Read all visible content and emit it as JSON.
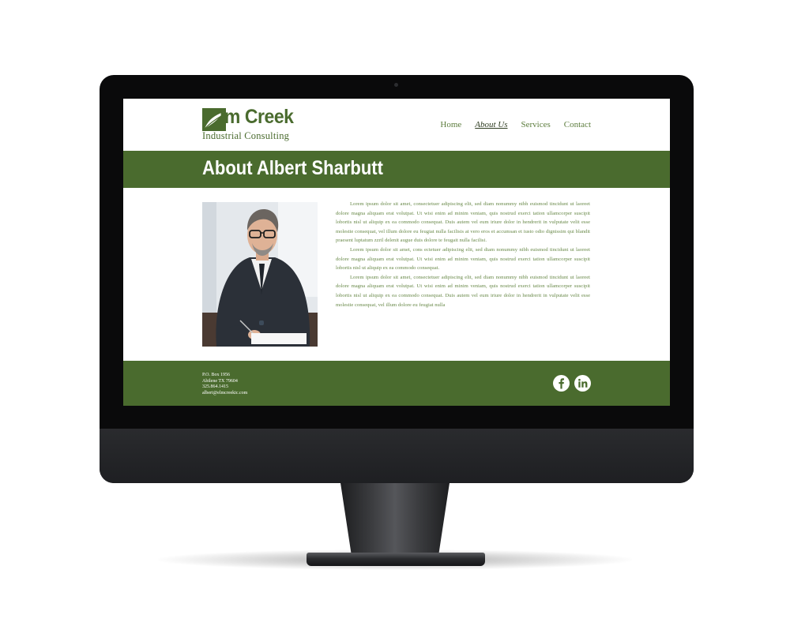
{
  "logo": {
    "title": "Elm Creek",
    "title_rest": "lm Creek",
    "subtitle": "Industrial Consulting"
  },
  "nav": {
    "items": [
      {
        "label": "Home",
        "active": false
      },
      {
        "label": "About Us",
        "active": true
      },
      {
        "label": "Services",
        "active": false
      },
      {
        "label": "Contact",
        "active": false
      }
    ]
  },
  "banner": {
    "title": "About Albert Sharbutt"
  },
  "bio": {
    "paragraphs": [
      "Lorem ipsum dolor sit amet, consectetuer adipiscing elit, sed diam nonummy nibh euismod tincidunt ut laoreet dolore magna aliquam erat volutpat. Ut wisi enim ad minim veniam, quis nostrud exerci tation ullamcorper suscipit lobortis nisl ut aliquip ex ea commodo consequat. Duis autem vel eum iriure dolor in hendrerit in vulputate velit esse molestie consequat, vel illum dolore eu feugiat nulla facilisis at vero eros et accumsan et iusto odio dignissim qui blandit praesent luptatum zzril delenit augue duis dolore te feugait nulla facilisi.",
      "Lorem ipsum dolor sit amet, cons ectetuer adipiscing elit, sed diam nonummy nibh euismod tincidunt ut laoreet dolore magna aliquam erat volutpat. Ut wisi enim ad minim veniam, quis nostrud exerci tation ullamcorper suscipit lobortis nisl ut aliquip ex ea commodo consequat.",
      "Lorem ipsum dolor sit amet, consectetuer adipiscing elit, sed diam nonummy nibh euismod tincidunt ut laoreet dolore magna aliquam erat volutpat. Ut wisi enim ad minim veniam, quis nostrud exerci tation ullamcorper suscipit lobortis nisl ut aliquip ex ea commodo consequat. Duis autem vel eum iriure dolor in hendrerit in vulputate velit esse molestie consequat, vel illum dolore eu feugiat nulla"
    ]
  },
  "footer": {
    "address_lines": [
      "P.O. Box 1956",
      "Abilene TX  79604",
      "325.864.1415",
      "albert@elmcreekic.com"
    ],
    "social": [
      {
        "icon": "facebook-icon",
        "glyph": "f"
      },
      {
        "icon": "linkedin-icon",
        "glyph": "in"
      }
    ]
  },
  "colors": {
    "brand_green": "#4a6b2e",
    "nav_green": "#5d7d3e",
    "body_text": "#6a8a4a",
    "active_nav": "#2f3d22",
    "bezel": "#0a0a0b"
  }
}
